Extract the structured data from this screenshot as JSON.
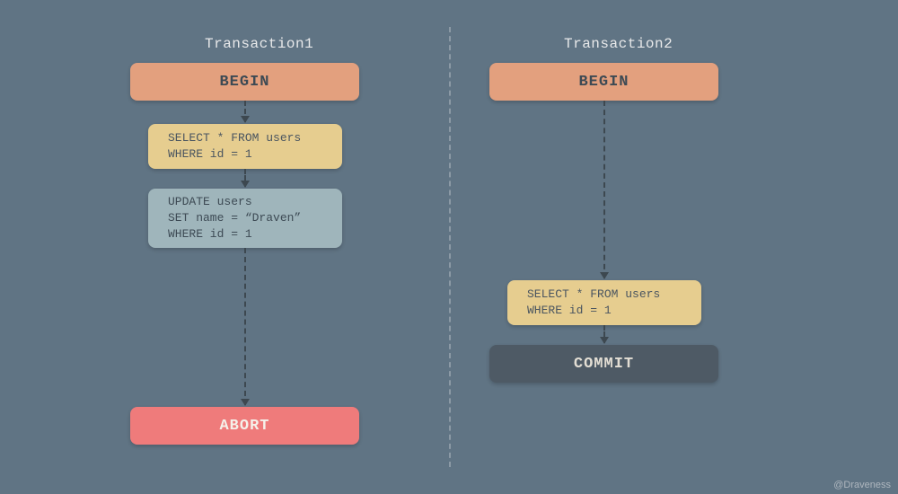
{
  "titles": {
    "t1": "Transaction1",
    "t2": "Transaction2"
  },
  "blocks": {
    "begin1": "BEGIN",
    "begin2": "BEGIN",
    "select1": "SELECT * FROM users\nWHERE id = 1",
    "update1": "UPDATE users\nSET name = “Draven”\nWHERE id = 1",
    "select2": "SELECT * FROM users\nWHERE id = 1",
    "abort": "ABORT",
    "commit": "COMMIT"
  },
  "credit": "@Draveness",
  "colors": {
    "bg": "#607484",
    "begin": "#e3a07e",
    "select": "#e6cd8f",
    "update": "#9fb5bb",
    "abort": "#ef7b7b",
    "commit": "#4e5a65"
  }
}
